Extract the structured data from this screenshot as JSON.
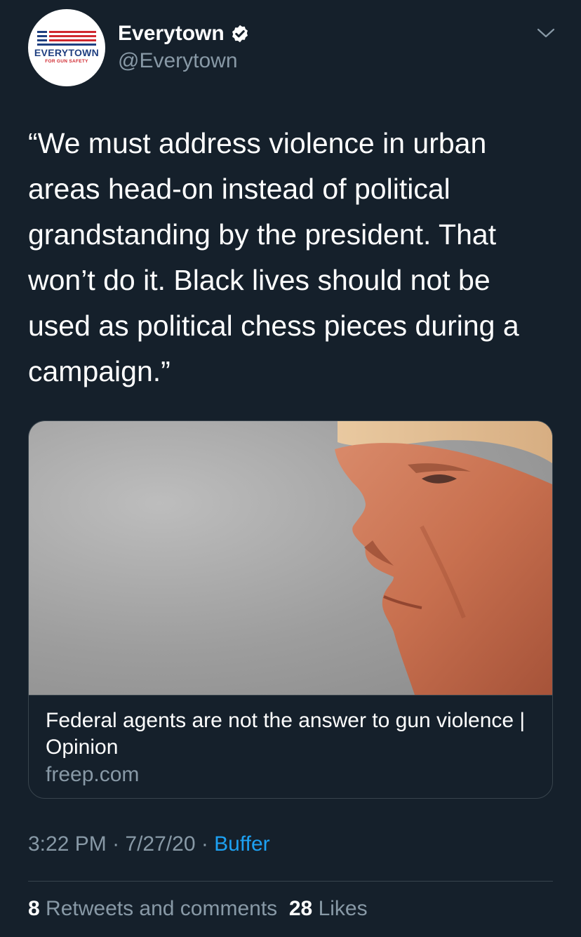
{
  "author": {
    "display_name": "Everytown",
    "handle": "@Everytown",
    "verified": true,
    "avatar_logo_text": "EVERYTOWN",
    "avatar_logo_subtext": "FOR GUN SAFETY"
  },
  "tweet": {
    "text": "“We must address violence in urban\nareas head-on instead of political\ngrandstanding by the president. That\nwon’t do it. Black lives should not be\nused as political chess pieces during a\ncampaign.”"
  },
  "card": {
    "title": "Federal agents are not the answer to gun violence | Opinion",
    "domain": "freep.com"
  },
  "meta": {
    "time": "3:22 PM",
    "separator": " · ",
    "date": "7/27/20",
    "source": "Buffer"
  },
  "stats": {
    "retweets_count": "8",
    "retweets_label": "Retweets and comments",
    "likes_count": "28",
    "likes_label": "Likes"
  },
  "colors": {
    "background": "#15202b",
    "text_primary": "#ffffff",
    "text_secondary": "#8899a6",
    "link": "#1da1f2",
    "border": "#38444d"
  },
  "icons": {
    "verified": "verified-badge-icon",
    "menu": "chevron-down-icon"
  }
}
